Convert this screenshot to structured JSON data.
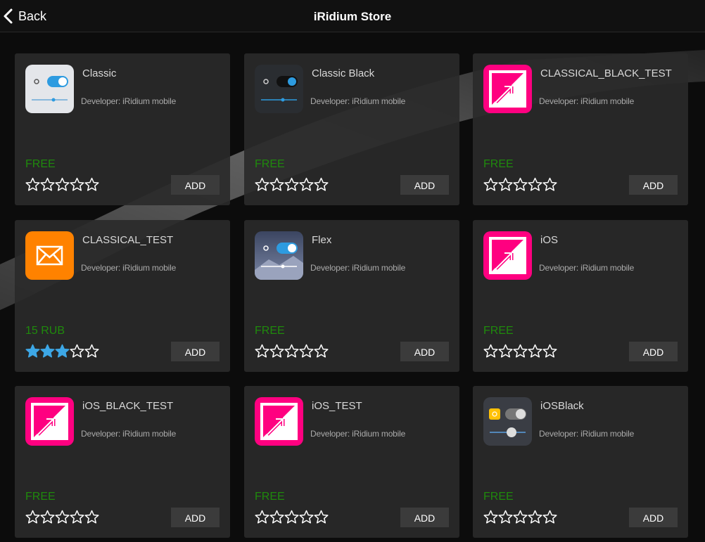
{
  "header": {
    "back_label": "Back",
    "title": "iRidium Store"
  },
  "colors": {
    "free_green": "#1f8a0c",
    "star_filled": "#3da7e6",
    "star_empty": "#ffffff",
    "pink_icon": "#ff0080",
    "orange_icon": "#ff8200"
  },
  "apps": [
    {
      "name": "Classic",
      "developer": "Developer: iRidium mobile",
      "price": "FREE",
      "rating": 0,
      "button": "ADD",
      "icon": "classic-theme-icon"
    },
    {
      "name": "Classic Black",
      "developer": "Developer: iRidium mobile",
      "price": "FREE",
      "rating": 0,
      "button": "ADD",
      "icon": "classic-black-theme-icon"
    },
    {
      "name": "CLASSICAL_BLACK_TEST",
      "developer": "Developer: iRidium mobile",
      "price": "FREE",
      "rating": 0,
      "button": "ADD",
      "icon": "iridium-arrow-icon"
    },
    {
      "name": "CLASSICAL_TEST",
      "developer": "Developer: iRidium mobile",
      "price": "15 RUB",
      "rating": 3,
      "button": "ADD",
      "icon": "envelope-icon"
    },
    {
      "name": "Flex",
      "developer": "Developer: iRidium mobile",
      "price": "FREE",
      "rating": 0,
      "button": "ADD",
      "icon": "flex-theme-icon"
    },
    {
      "name": "iOS",
      "developer": "Developer: iRidium mobile",
      "price": "FREE",
      "rating": 0,
      "button": "ADD",
      "icon": "iridium-arrow-icon"
    },
    {
      "name": "iOS_BLACK_TEST",
      "developer": "Developer: iRidium mobile",
      "price": "FREE",
      "rating": 0,
      "button": "ADD",
      "icon": "iridium-arrow-icon"
    },
    {
      "name": "iOS_TEST",
      "developer": "Developer: iRidium mobile",
      "price": "FREE",
      "rating": 0,
      "button": "ADD",
      "icon": "iridium-arrow-icon"
    },
    {
      "name": "iOSBlack",
      "developer": "Developer: iRidium mobile",
      "price": "FREE",
      "rating": 0,
      "button": "ADD",
      "icon": "ios-black-theme-icon"
    }
  ]
}
